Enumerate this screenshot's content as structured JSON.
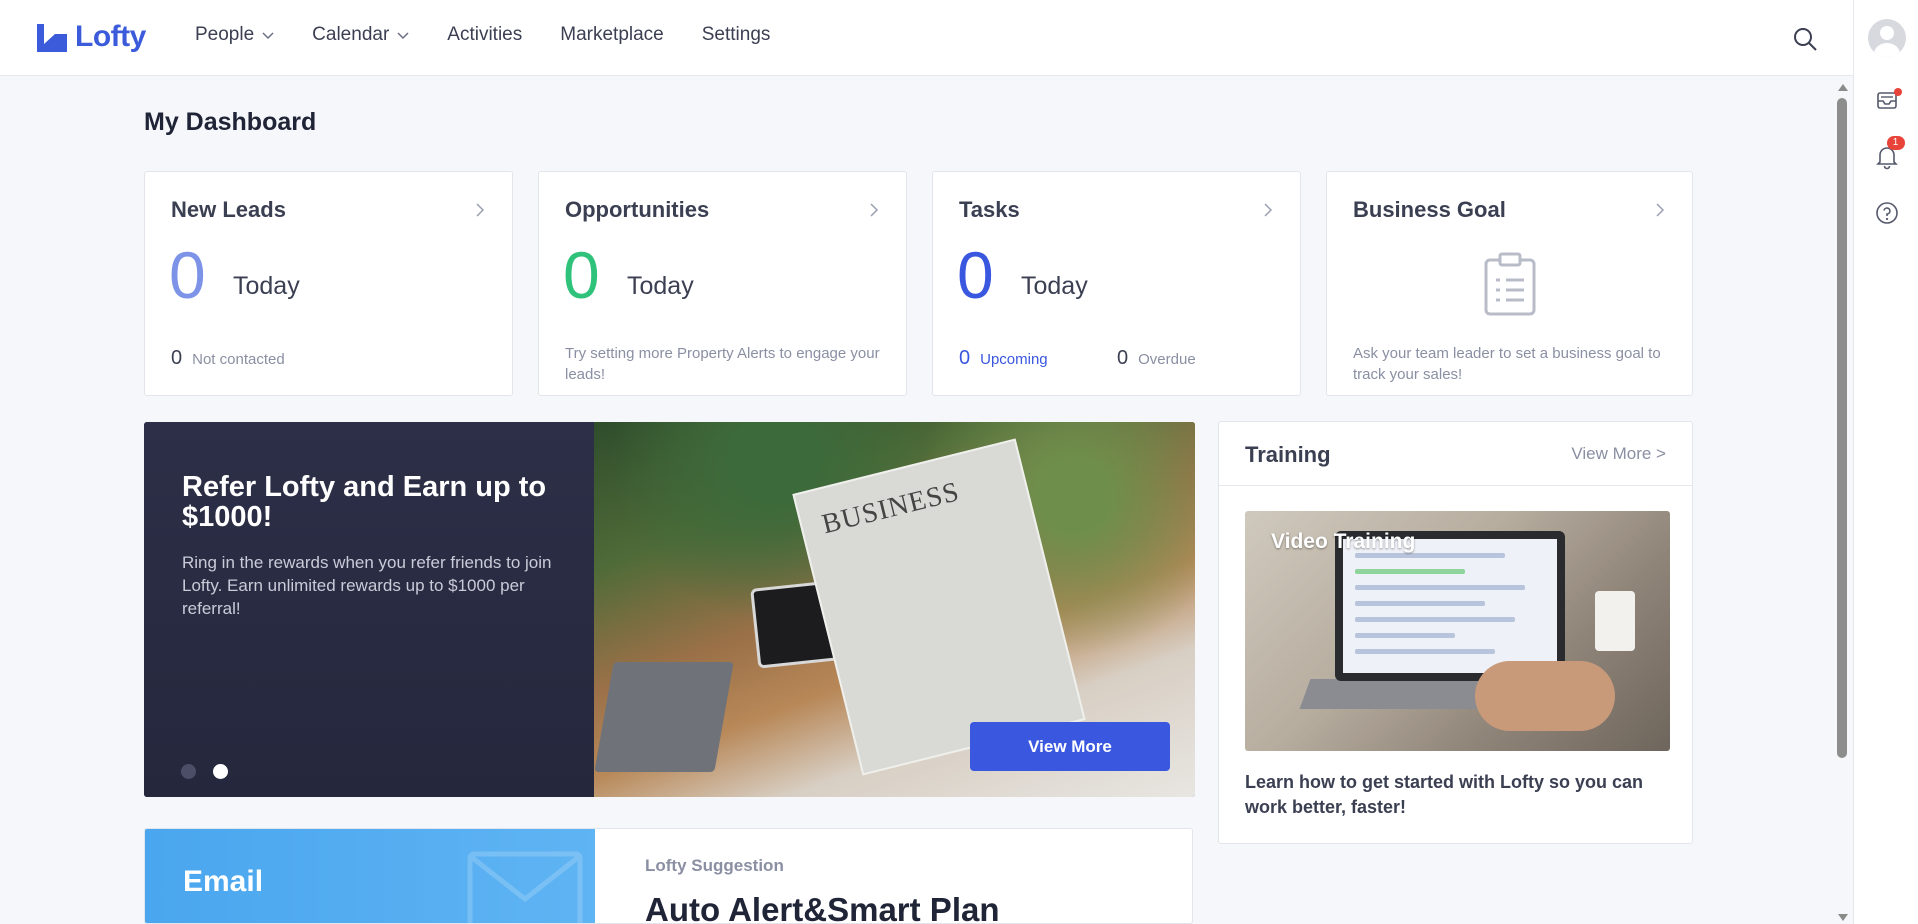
{
  "app": {
    "name": "Lofty",
    "brand_color": "#3b5bdb"
  },
  "nav": {
    "items": [
      {
        "label": "People",
        "has_dropdown": true
      },
      {
        "label": "Calendar",
        "has_dropdown": true
      },
      {
        "label": "Activities",
        "has_dropdown": false
      },
      {
        "label": "Marketplace",
        "has_dropdown": false
      },
      {
        "label": "Settings",
        "has_dropdown": false
      }
    ]
  },
  "rail": {
    "notification_count": "1",
    "icons": [
      "avatar",
      "inbox-icon",
      "bell-icon",
      "help-icon"
    ]
  },
  "page": {
    "title": "My Dashboard"
  },
  "cards": {
    "leads": {
      "title": "New Leads",
      "count": "0",
      "period": "Today",
      "sub_count": "0",
      "sub_label": "Not contacted",
      "count_color": "#7c93e8"
    },
    "opportunities": {
      "title": "Opportunities",
      "count": "0",
      "period": "Today",
      "hint": "Try setting more Property Alerts to engage your leads!",
      "count_color": "#2fc27a"
    },
    "tasks": {
      "title": "Tasks",
      "count": "0",
      "period": "Today",
      "upcoming_count": "0",
      "upcoming_label": "Upcoming",
      "overdue_count": "0",
      "overdue_label": "Overdue",
      "count_color": "#3a57e0"
    },
    "goal": {
      "title": "Business Goal",
      "hint": "Ask your team leader to set a business goal to track your sales!",
      "icon": "clipboard-icon"
    }
  },
  "promo": {
    "title": "Refer Lofty and Earn up to $1000!",
    "description": "Ring in the rewards when you refer friends to join Lofty. Earn unlimited rewards up to $1000 per referral!",
    "button": "View More",
    "newspaper_text": "BUSINESS",
    "slide_count": 2,
    "active_slide": 2
  },
  "training": {
    "title": "Training",
    "view_more": "View More >",
    "image_label": "Video Training",
    "description": "Learn how to get started with Lofty so you can work better, faster!"
  },
  "suggestion": {
    "tile_label": "Email",
    "kicker": "Lofty Suggestion",
    "title": "Auto Alert&Smart Plan"
  }
}
